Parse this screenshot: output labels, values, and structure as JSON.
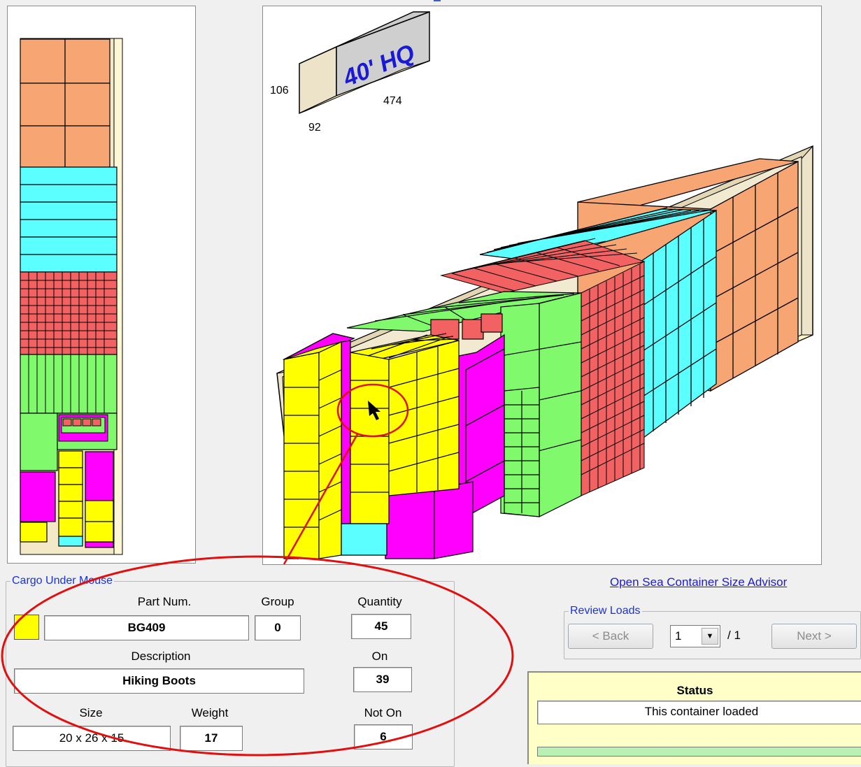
{
  "container_label": {
    "type": "40' HQ",
    "height": "106",
    "width": "92",
    "length": "474"
  },
  "advisor_link": "Open Sea Container Size Advisor",
  "cargo": {
    "legend": "Cargo Under Mouse",
    "part_num_label": "Part Num.",
    "part_num": "BG409",
    "group_label": "Group",
    "group": "0",
    "quantity_label": "Quantity",
    "quantity": "45",
    "description_label": "Description",
    "description": "Hiking Boots",
    "on_label": "On",
    "on": "39",
    "size_label": "Size",
    "size": "20 x 26 x 15",
    "weight_label": "Weight",
    "weight": "17",
    "not_on_label": "Not On",
    "not_on": "6",
    "swatch_color": "#ffff00"
  },
  "review": {
    "legend": "Review Loads",
    "back_label": "< Back",
    "load_selected": "1",
    "load_total": "/ 1",
    "next_label": "Next >"
  },
  "status": {
    "title": "Status",
    "message": "This container loaded"
  },
  "colors": {
    "orange": "#f7a572",
    "cyan": "#5cffff",
    "red": "#f26262",
    "green": "#80fa6c",
    "magenta": "#ff00ff",
    "yellow": "#ffff00",
    "container_wall": "#ede3c9",
    "annotation": "#e01010"
  }
}
